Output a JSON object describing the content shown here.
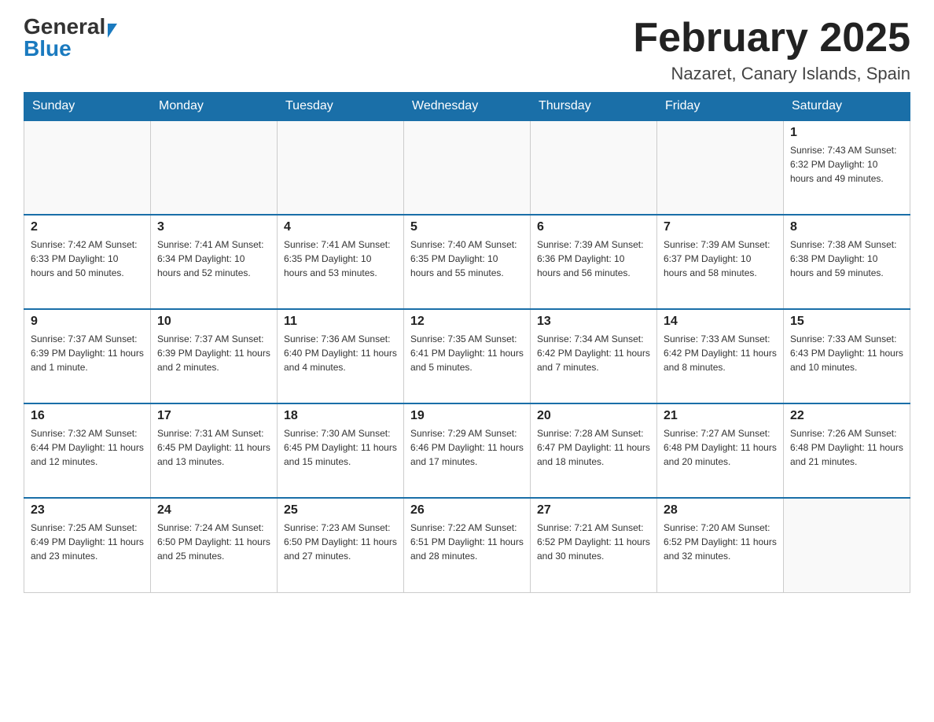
{
  "logo": {
    "general": "General",
    "blue": "Blue"
  },
  "header": {
    "month_title": "February 2025",
    "location": "Nazaret, Canary Islands, Spain"
  },
  "weekdays": [
    "Sunday",
    "Monday",
    "Tuesday",
    "Wednesday",
    "Thursday",
    "Friday",
    "Saturday"
  ],
  "weeks": [
    [
      {
        "day": "",
        "info": ""
      },
      {
        "day": "",
        "info": ""
      },
      {
        "day": "",
        "info": ""
      },
      {
        "day": "",
        "info": ""
      },
      {
        "day": "",
        "info": ""
      },
      {
        "day": "",
        "info": ""
      },
      {
        "day": "1",
        "info": "Sunrise: 7:43 AM\nSunset: 6:32 PM\nDaylight: 10 hours and 49 minutes."
      }
    ],
    [
      {
        "day": "2",
        "info": "Sunrise: 7:42 AM\nSunset: 6:33 PM\nDaylight: 10 hours and 50 minutes."
      },
      {
        "day": "3",
        "info": "Sunrise: 7:41 AM\nSunset: 6:34 PM\nDaylight: 10 hours and 52 minutes."
      },
      {
        "day": "4",
        "info": "Sunrise: 7:41 AM\nSunset: 6:35 PM\nDaylight: 10 hours and 53 minutes."
      },
      {
        "day": "5",
        "info": "Sunrise: 7:40 AM\nSunset: 6:35 PM\nDaylight: 10 hours and 55 minutes."
      },
      {
        "day": "6",
        "info": "Sunrise: 7:39 AM\nSunset: 6:36 PM\nDaylight: 10 hours and 56 minutes."
      },
      {
        "day": "7",
        "info": "Sunrise: 7:39 AM\nSunset: 6:37 PM\nDaylight: 10 hours and 58 minutes."
      },
      {
        "day": "8",
        "info": "Sunrise: 7:38 AM\nSunset: 6:38 PM\nDaylight: 10 hours and 59 minutes."
      }
    ],
    [
      {
        "day": "9",
        "info": "Sunrise: 7:37 AM\nSunset: 6:39 PM\nDaylight: 11 hours and 1 minute."
      },
      {
        "day": "10",
        "info": "Sunrise: 7:37 AM\nSunset: 6:39 PM\nDaylight: 11 hours and 2 minutes."
      },
      {
        "day": "11",
        "info": "Sunrise: 7:36 AM\nSunset: 6:40 PM\nDaylight: 11 hours and 4 minutes."
      },
      {
        "day": "12",
        "info": "Sunrise: 7:35 AM\nSunset: 6:41 PM\nDaylight: 11 hours and 5 minutes."
      },
      {
        "day": "13",
        "info": "Sunrise: 7:34 AM\nSunset: 6:42 PM\nDaylight: 11 hours and 7 minutes."
      },
      {
        "day": "14",
        "info": "Sunrise: 7:33 AM\nSunset: 6:42 PM\nDaylight: 11 hours and 8 minutes."
      },
      {
        "day": "15",
        "info": "Sunrise: 7:33 AM\nSunset: 6:43 PM\nDaylight: 11 hours and 10 minutes."
      }
    ],
    [
      {
        "day": "16",
        "info": "Sunrise: 7:32 AM\nSunset: 6:44 PM\nDaylight: 11 hours and 12 minutes."
      },
      {
        "day": "17",
        "info": "Sunrise: 7:31 AM\nSunset: 6:45 PM\nDaylight: 11 hours and 13 minutes."
      },
      {
        "day": "18",
        "info": "Sunrise: 7:30 AM\nSunset: 6:45 PM\nDaylight: 11 hours and 15 minutes."
      },
      {
        "day": "19",
        "info": "Sunrise: 7:29 AM\nSunset: 6:46 PM\nDaylight: 11 hours and 17 minutes."
      },
      {
        "day": "20",
        "info": "Sunrise: 7:28 AM\nSunset: 6:47 PM\nDaylight: 11 hours and 18 minutes."
      },
      {
        "day": "21",
        "info": "Sunrise: 7:27 AM\nSunset: 6:48 PM\nDaylight: 11 hours and 20 minutes."
      },
      {
        "day": "22",
        "info": "Sunrise: 7:26 AM\nSunset: 6:48 PM\nDaylight: 11 hours and 21 minutes."
      }
    ],
    [
      {
        "day": "23",
        "info": "Sunrise: 7:25 AM\nSunset: 6:49 PM\nDaylight: 11 hours and 23 minutes."
      },
      {
        "day": "24",
        "info": "Sunrise: 7:24 AM\nSunset: 6:50 PM\nDaylight: 11 hours and 25 minutes."
      },
      {
        "day": "25",
        "info": "Sunrise: 7:23 AM\nSunset: 6:50 PM\nDaylight: 11 hours and 27 minutes."
      },
      {
        "day": "26",
        "info": "Sunrise: 7:22 AM\nSunset: 6:51 PM\nDaylight: 11 hours and 28 minutes."
      },
      {
        "day": "27",
        "info": "Sunrise: 7:21 AM\nSunset: 6:52 PM\nDaylight: 11 hours and 30 minutes."
      },
      {
        "day": "28",
        "info": "Sunrise: 7:20 AM\nSunset: 6:52 PM\nDaylight: 11 hours and 32 minutes."
      },
      {
        "day": "",
        "info": ""
      }
    ]
  ]
}
